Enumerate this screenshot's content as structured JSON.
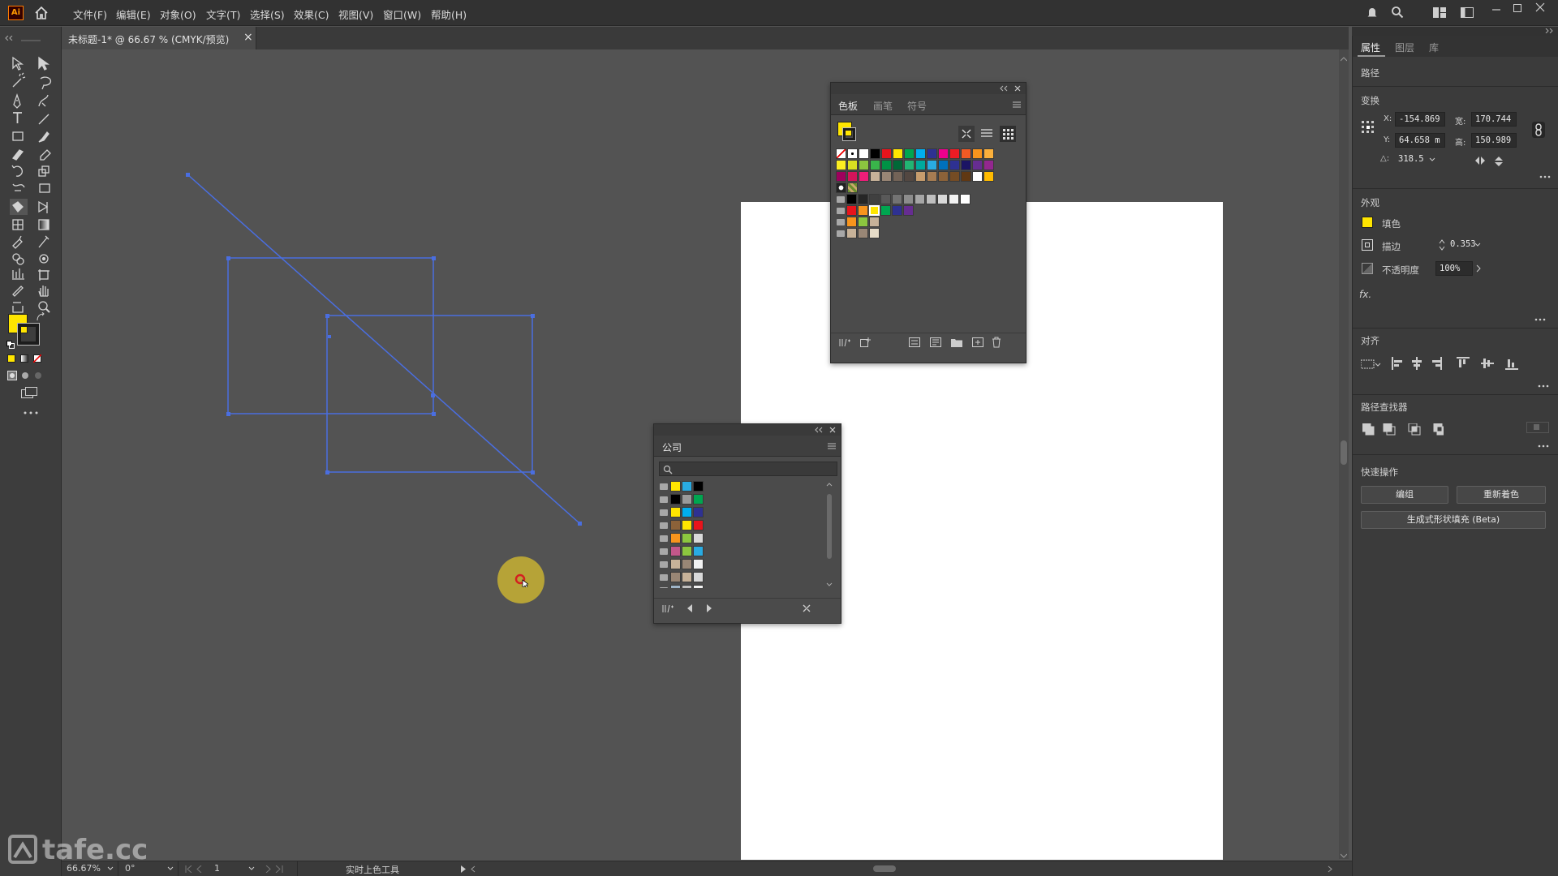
{
  "app": {
    "logo": "Ai",
    "menu": [
      "文件(F)",
      "编辑(E)",
      "对象(O)",
      "文字(T)",
      "选择(S)",
      "效果(C)",
      "视图(V)",
      "窗口(W)",
      "帮助(H)"
    ]
  },
  "document_tab": {
    "title": "未标题-1* @ 66.67 % (CMYK/预览)",
    "close": "×"
  },
  "right_panel": {
    "tabs": [
      "属性",
      "图层",
      "库"
    ],
    "path_label": "路径",
    "transform": {
      "title": "变换",
      "x_label": "X:",
      "x_value": "-154.869",
      "y_label": "Y:",
      "y_value": "64.658 m",
      "w_label": "宽:",
      "w_value": "170.744",
      "h_label": "高:",
      "h_value": "150.989",
      "angle_label": "△:",
      "angle_value": "318.5"
    },
    "appearance": {
      "title": "外观",
      "fill_label": "填色",
      "stroke_label": "描边",
      "stroke_value": "0.353",
      "opacity_label": "不透明度",
      "opacity_value": "100%",
      "fx": "fx."
    },
    "align_title": "对齐",
    "pathfinder_title": "路径查找器",
    "quick_actions": {
      "title": "快速操作",
      "edit_button": "编组",
      "recolor_button": "重新着色",
      "generative_button": "生成式形状填充 (Beta)"
    }
  },
  "swatches_panel": {
    "tabs": [
      "色板",
      "画笔",
      "符号"
    ]
  },
  "company_panel": {
    "tab": "公司"
  },
  "status_bar": {
    "zoom": "66.67%",
    "rotation": "0°",
    "page": "1",
    "tool": "实时上色工具"
  },
  "watermark": "tafe.cc",
  "colors": {
    "fill": "#ffe500",
    "selection": "#4a6ee0",
    "cursor_ring": "#c8b232"
  }
}
